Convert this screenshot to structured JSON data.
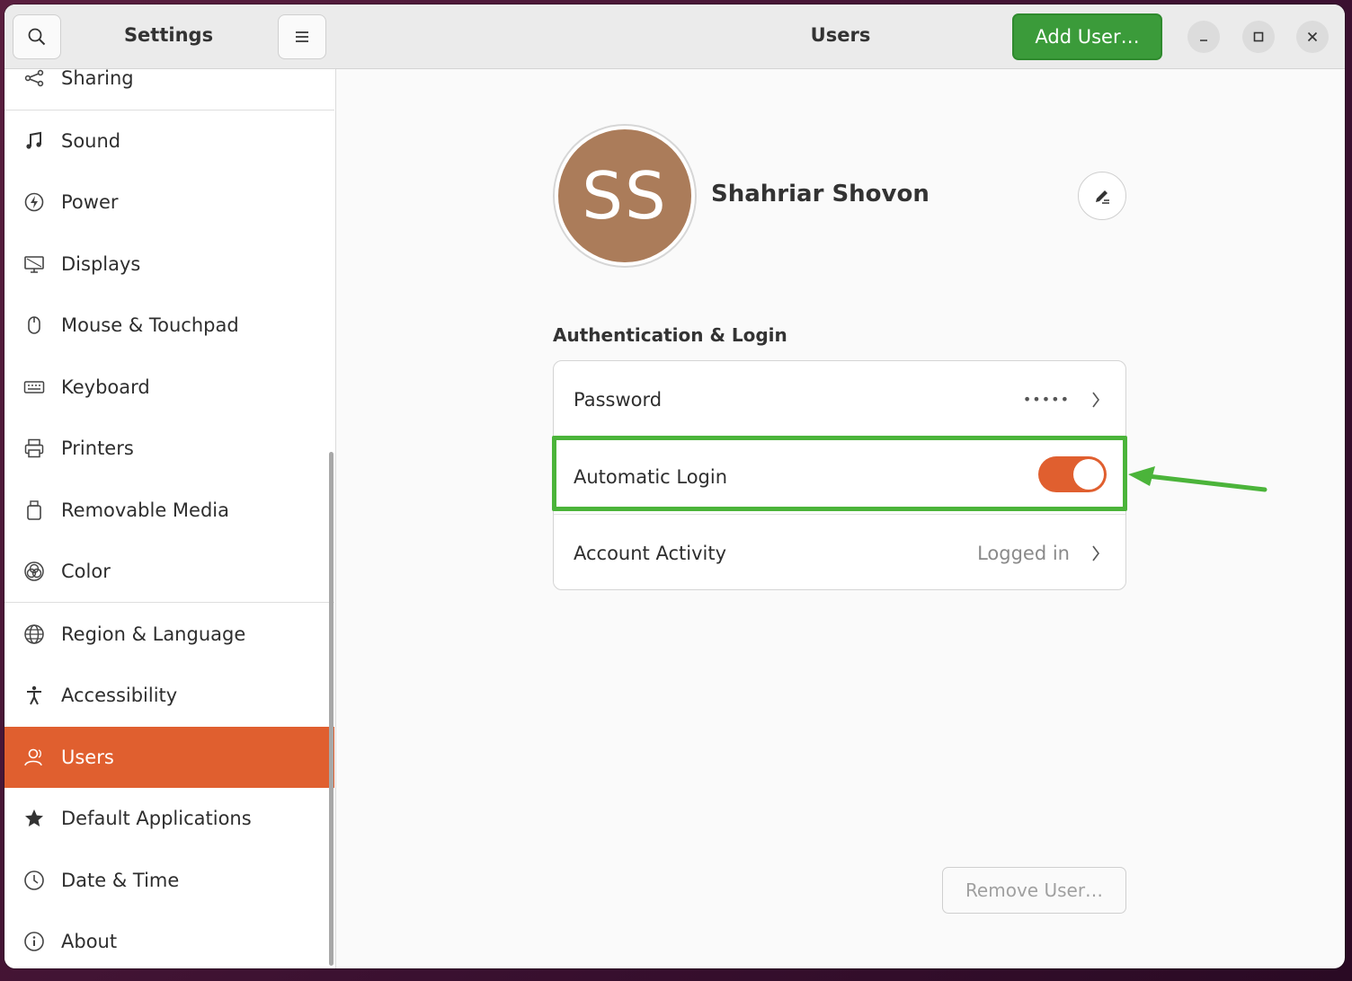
{
  "sidebar": {
    "title": "Settings",
    "items": [
      {
        "label": "Sharing",
        "icon": "share-icon"
      },
      {
        "label": "Sound",
        "icon": "music-note-icon"
      },
      {
        "label": "Power",
        "icon": "power-icon"
      },
      {
        "label": "Displays",
        "icon": "display-icon"
      },
      {
        "label": "Mouse & Touchpad",
        "icon": "mouse-icon"
      },
      {
        "label": "Keyboard",
        "icon": "keyboard-icon"
      },
      {
        "label": "Printers",
        "icon": "printer-icon"
      },
      {
        "label": "Removable Media",
        "icon": "usb-drive-icon"
      },
      {
        "label": "Color",
        "icon": "color-icon"
      },
      {
        "label": "Region & Language",
        "icon": "globe-icon"
      },
      {
        "label": "Accessibility",
        "icon": "accessibility-icon"
      },
      {
        "label": "Users",
        "icon": "users-icon",
        "active": true
      },
      {
        "label": "Default Applications",
        "icon": "star-icon"
      },
      {
        "label": "Date & Time",
        "icon": "clock-icon"
      },
      {
        "label": "About",
        "icon": "info-icon"
      }
    ]
  },
  "header": {
    "title": "Users",
    "add_user_label": "Add User…"
  },
  "user": {
    "initials": "SS",
    "name": "Shahriar Shovon",
    "avatar_color": "#ab7c5a"
  },
  "auth": {
    "section_title": "Authentication & Login",
    "password_label": "Password",
    "password_value": "•••••",
    "auto_login_label": "Automatic Login",
    "auto_login_enabled": true,
    "activity_label": "Account Activity",
    "activity_value": "Logged in"
  },
  "remove_user_label": "Remove User…",
  "colors": {
    "accent": "#e05f2f",
    "add_button": "#3b9b3a",
    "highlight": "#4bb43a"
  }
}
